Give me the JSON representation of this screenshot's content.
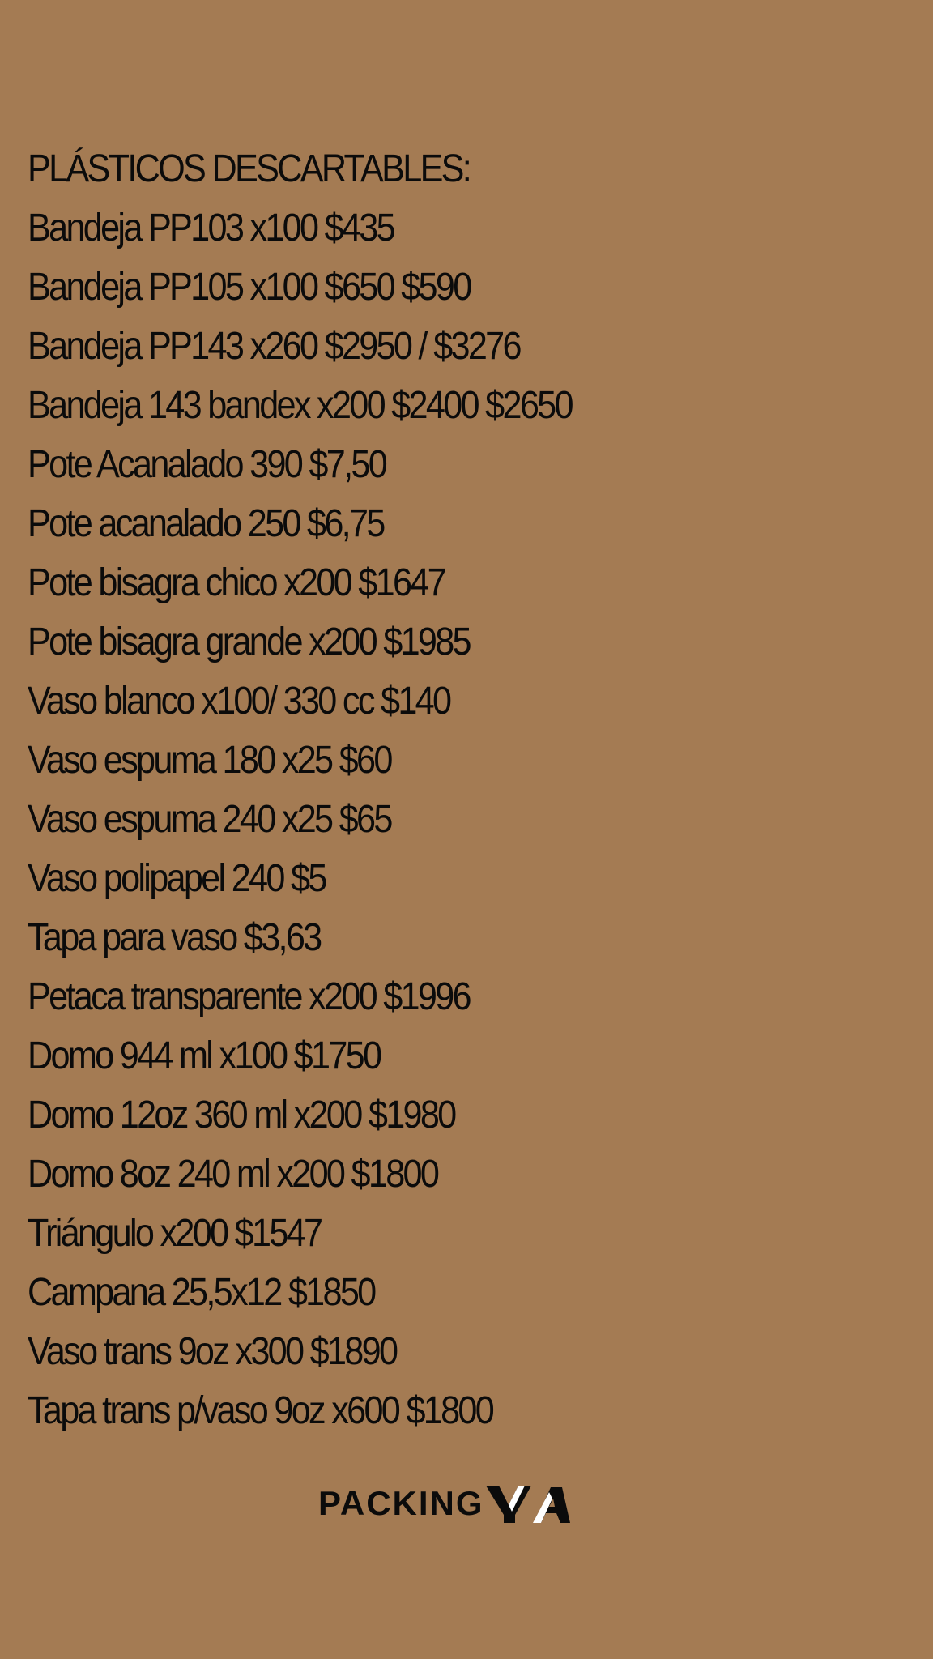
{
  "price_list": {
    "heading": "PLÁSTICOS DESCARTABLES:",
    "items": [
      "Bandeja PP103 x100 $435",
      "Bandeja PP105 x100 $650 $590",
      "Bandeja PP143 x260 $2950 / $3276",
      "Bandeja 143 bandex x200 $2400 $2650",
      "Pote Acanalado 390 $7,50",
      "Pote acanalado 250 $6,75",
      "Pote bisagra chico x200 $1647",
      "Pote bisagra grande x200 $1985",
      "Vaso blanco x100/ 330 cc $140",
      "Vaso espuma 180 x25 $60",
      "Vaso espuma 240 x25 $65",
      "Vaso polipapel 240 $5",
      "Tapa para vaso $3,63",
      "Petaca transparente x200 $1996",
      "Domo 944 ml x100 $1750",
      "Domo 12oz 360 ml x200 $1980",
      "Domo 8oz 240 ml x200 $1800",
      "Triángulo x200 $1547",
      "Campana 25,5x12 $1850",
      "Vaso trans 9oz x300 $1890",
      "Tapa trans p/vaso 9oz x600 $1800"
    ]
  },
  "brand": {
    "wordmark": "PACKING",
    "mark_text": "YA",
    "mark_icon": "ya-logo-icon"
  },
  "colors": {
    "background": "#a47b53",
    "text": "#0b0b0b",
    "logo_light": "#ffffff",
    "logo_dark": "#0b0b0b"
  }
}
